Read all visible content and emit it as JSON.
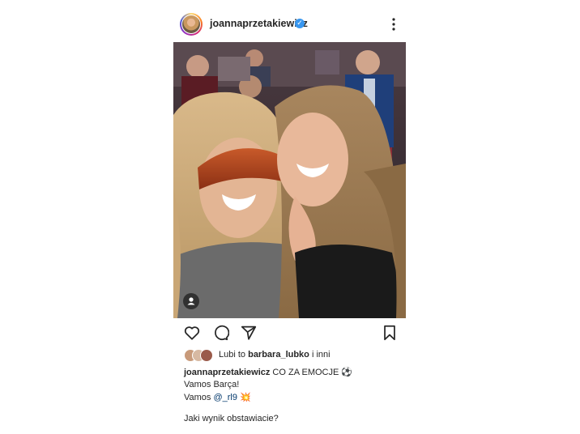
{
  "header": {
    "username": "joannaprzetakiewicz",
    "verified_icon": "verified-check-icon",
    "more_icon": "more-options-icon"
  },
  "actions": {
    "like_icon": "heart-icon",
    "comment_icon": "comment-icon",
    "share_icon": "send-icon",
    "save_icon": "bookmark-icon"
  },
  "likes": {
    "prefix": "Lubi to ",
    "user": "barbara_lubko",
    "suffix": " i inni"
  },
  "caption": {
    "username": "joannaprzetakiewicz",
    "line1_text": " CO ZA EMOCJE ",
    "line1_emoji": "⚽",
    "line2": "Vamos Barça!",
    "line3_prefix": "Vamos ",
    "line3_mention": "@_rl9",
    "line3_emoji": "💥"
  },
  "question": "Jaki wynik obstawiacie?"
}
